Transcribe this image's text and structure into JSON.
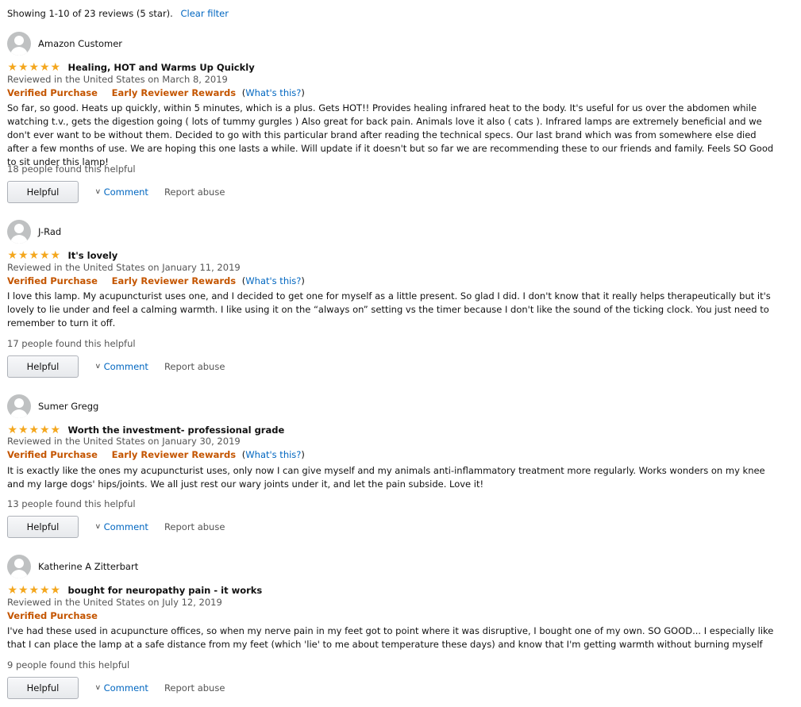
{
  "topbar": {
    "summary": "Showing 1-10 of 23 reviews (5 star).",
    "clear_filter": "Clear filter"
  },
  "labels": {
    "verified": "Verified Purchase",
    "rewards": "Early Reviewer Rewards",
    "paren_open": "(",
    "whats_this": "What's this?",
    "paren_close": ")",
    "helpful_button": "Helpful",
    "comment": "Comment",
    "report": "Report abuse"
  },
  "icons": {
    "star": "star-icon",
    "avatar": "avatar-icon",
    "chevron": "chevron-down-icon"
  },
  "colors": {
    "star": "#f4a71e",
    "link": "#0066c0",
    "verified": "#c45500"
  },
  "reviews": [
    {
      "name": "Amazon Customer",
      "rating": 5,
      "title": "Healing, HOT and Warms Up Quickly",
      "date": "Reviewed in the United States on March 8, 2019",
      "early_reviewer": true,
      "body": "So far, so good. Heats up quickly, within 5 minutes, which is a plus. Gets HOT!! Provides healing infrared heat to the body. It's useful for us over the abdomen while watching t.v., gets the digestion going ( lots of tummy gurgles ) Also great for back pain. Animals love it also ( cats ). Infrared lamps are extremely beneficial and we don't ever want to be without them. Decided to go with this particular brand after reading the technical specs. Our last brand which was from somewhere else died after a few months of use. We are hoping this one lasts a while. Will update if it doesn't but so far we are recommending these to our friends and family. Feels SO Good to sit under this lamp!",
      "helpful_count": "18 people found this helpful"
    },
    {
      "name": "J-Rad",
      "rating": 5,
      "title": "It's lovely",
      "date": "Reviewed in the United States on January 11, 2019",
      "early_reviewer": true,
      "body": "I love this lamp. My acupuncturist uses one, and I decided to get one for myself as a little present. So glad I did. I don't know that it really helps therapeutically but it's lovely to lie under and feel a calming warmth. I like using it on the “always on” setting vs the timer because I don't like the sound of the ticking clock. You just need to remember to turn it off.",
      "helpful_count": "17 people found this helpful"
    },
    {
      "name": "Sumer Gregg",
      "rating": 5,
      "title": "Worth the investment- professional grade",
      "date": "Reviewed in the United States on January 30, 2019",
      "early_reviewer": true,
      "body": "It is exactly like the ones my acupuncturist uses, only now I can give myself and my animals anti-inflammatory treatment more regularly. Works wonders on my knee and my large dogs' hips/joints. We all just rest our wary joints under it, and let the pain subside. Love it!",
      "helpful_count": "13 people found this helpful"
    },
    {
      "name": "Katherine A Zitterbart",
      "rating": 5,
      "title": "bought for neuropathy pain - it works",
      "date": "Reviewed in the United States on July 12, 2019",
      "early_reviewer": false,
      "body": "I've had these used in acupuncture offices, so when my nerve pain in my feet got to point where it was disruptive, I bought one of my own. SO GOOD... I especially like that I can place the lamp at a safe distance from my feet (which 'lie' to me about temperature these days) and know that I'm getting warmth without burning myself",
      "helpful_count": "9 people found this helpful"
    }
  ]
}
